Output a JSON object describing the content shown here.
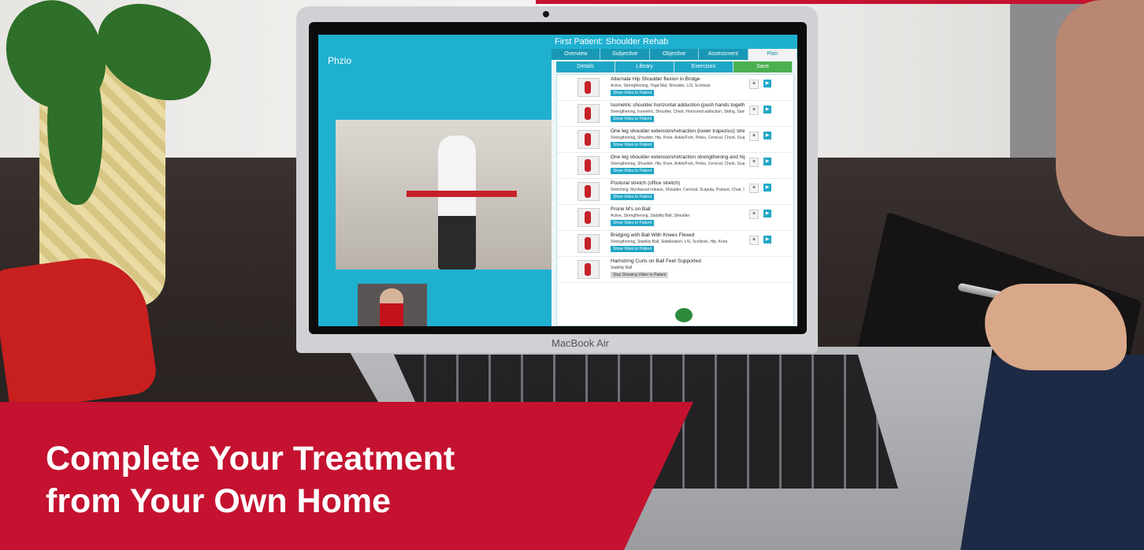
{
  "banner": {
    "line1": "Complete Your Treatment",
    "line2": "from Your Own Home",
    "color": "#c41230"
  },
  "laptop": {
    "brand": "MacBook Air"
  },
  "app": {
    "logo": "Phzio",
    "title": "First Patient: Shoulder Rehab",
    "tabs": [
      "Overview",
      "Subjective",
      "Objective",
      "Assessment",
      "Plan"
    ],
    "subtabs": [
      "Details",
      "Library",
      "Exercises",
      "Save"
    ],
    "exercises_count": "8",
    "exercises": [
      {
        "name": "Alternate Hip Shoulder flexion in Bridge",
        "tags": "Active, Strengthening, Yoga Mat, Shoulder, L/S, Scoliosis",
        "button": "Show Video to Patient"
      },
      {
        "name": "Isometric shoulder horizontal adduction (push hands together)",
        "tags": "Strengthening, Isometric, Shoulder, Chest, Horizontal adduction, Sitting, Stand...",
        "button": "Show Video to Patient"
      },
      {
        "name": "One leg shoulder extension/retraction (lower trapezius) strengthening with elastic (row)",
        "tags": "Strengthening, Shoulder, Hip, Knee, Ankle/Foot, Pelvis, Cervical, Chest, Scapul...",
        "button": "Show Video to Patient"
      },
      {
        "name": "One leg shoulder extension/retraction strengthening and hip flexion with elastic (walking mechanics)",
        "tags": "Strengthening, Shoulder, Hip, Knee, Ankle/Foot, Pelvis, Cervical, Chest, Scapul...",
        "button": "Show Video to Patient"
      },
      {
        "name": "Postural stretch (office stretch)",
        "tags": "Stretching, Myofascial release, Shoulder, Cervical, Scapula, Posture, Chair, Sitt...",
        "button": "Show Video to Patient"
      },
      {
        "name": "Prone M's on Ball",
        "tags": "Active, Strengthening, Stability Ball, Shoulder",
        "button": "Show Video to Patient"
      },
      {
        "name": "Bridging with Ball With Knees Flexed",
        "tags": "Strengthening, Stability Ball, Stabilization, L/S, Scoliosis, Hip, Knee",
        "button": "Show Video to Patient"
      },
      {
        "name": "Hamstring Curls on Ball Feet Supported",
        "tags": "Stability Ball",
        "button": "Stop Showing Video to Patient"
      }
    ],
    "colors": {
      "accent": "#1fb0d0",
      "save": "#4caf50"
    }
  }
}
